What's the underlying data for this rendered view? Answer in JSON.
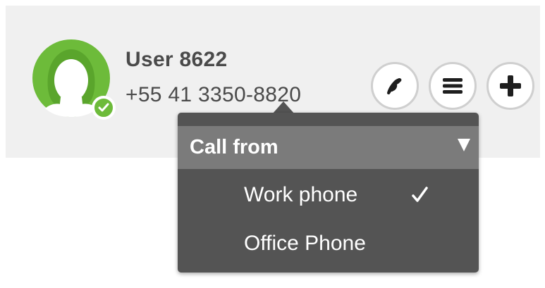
{
  "contact": {
    "name": "User 8622",
    "phone": "+55 41 3350-8820",
    "status": "online",
    "avatar_icon": "user-avatar-female-icon",
    "status_icon": "check-icon"
  },
  "actions": [
    {
      "id": "call",
      "icon": "phone-icon"
    },
    {
      "id": "menu",
      "icon": "hamburger-menu-icon"
    },
    {
      "id": "add",
      "icon": "plus-icon"
    }
  ],
  "call_from_menu": {
    "title": "Call from",
    "caret_icon": "triangle-down-icon",
    "items": [
      {
        "label": "Work phone",
        "selected": true
      },
      {
        "label": "Office Phone",
        "selected": false
      }
    ]
  },
  "colors": {
    "avatar_green": "#6dbb3a",
    "dropdown_bg": "#545454",
    "dropdown_header": "#7b7b7b",
    "header_bg": "#f0f0f0",
    "text_dark": "#4a4a4a"
  }
}
